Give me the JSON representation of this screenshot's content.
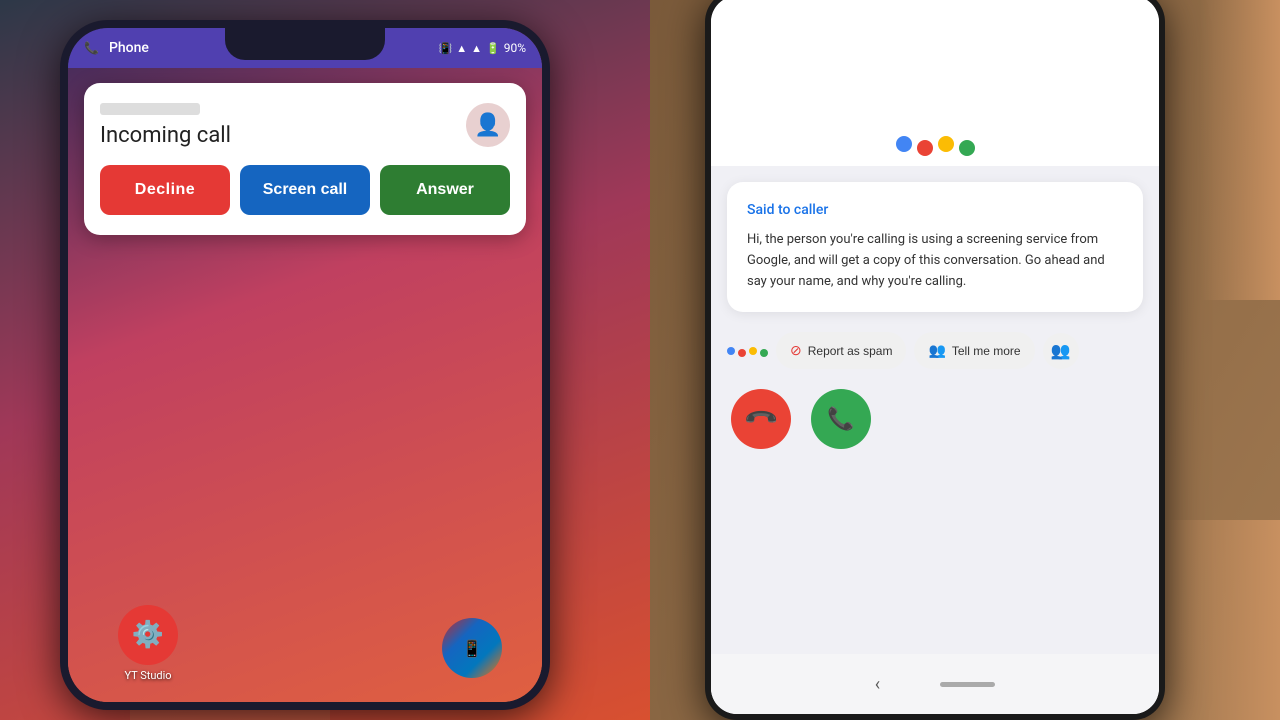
{
  "left_phone": {
    "status_bar": {
      "app_name": "Phone",
      "battery": "90%",
      "phone_icon": "📞"
    },
    "call_card": {
      "incoming_label": "Incoming call",
      "decline_btn": "Decline",
      "screen_btn": "Screen call",
      "answer_btn": "Answer"
    },
    "home_icons": [
      {
        "label": "YT Studio",
        "color": "#e53935",
        "icon": "⚙"
      },
      {
        "label": "",
        "color": "transparent",
        "icon": ""
      },
      {
        "label": "",
        "color": "#c62828",
        "icon": "📱"
      }
    ]
  },
  "right_phone": {
    "said_to_caller": "Said to caller",
    "screening_text": "Hi, the person you're calling is using a screening service from Google, and will get a copy of this conversation. Go ahead and say your name, and why you're calling.",
    "report_spam_btn": "Report as spam",
    "tell_more_btn": "Tell me more",
    "google_dots": [
      {
        "color": "#4285f4"
      },
      {
        "color": "#ea4335"
      },
      {
        "color": "#fbbc04"
      },
      {
        "color": "#34a853"
      }
    ]
  }
}
